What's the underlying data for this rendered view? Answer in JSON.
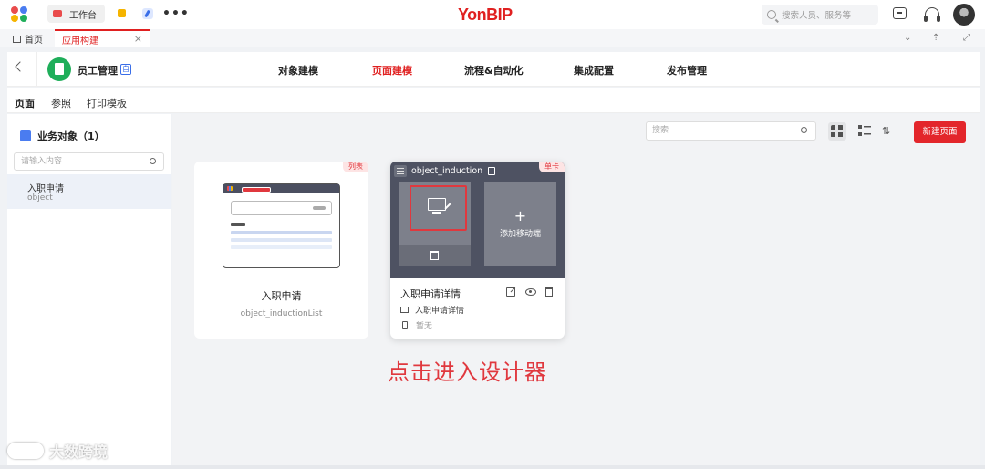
{
  "topbar": {
    "workbench_label": "工作台",
    "brand": "YonBIP",
    "search_placeholder": "搜索人员、服务等"
  },
  "tabs": {
    "home": "首页",
    "app": "应用构建",
    "close": "×"
  },
  "app_header": {
    "app_name": "员工管理",
    "badge": "自",
    "nav": [
      "对象建模",
      "页面建模",
      "流程&自动化",
      "集成配置",
      "发布管理"
    ],
    "active_nav": "页面建模"
  },
  "subtabs": [
    "页面",
    "参照",
    "打印模板"
  ],
  "sidebar": {
    "title": "业务对象（1）",
    "search_placeholder": "请输入内容",
    "items": [
      {
        "name": "入职申请",
        "code": "object"
      }
    ]
  },
  "main": {
    "search_placeholder": "搜索",
    "new_page_button": "新建页面",
    "cards": [
      {
        "tag": "列表",
        "title": "入职申请",
        "subtitle": "object_inductionList"
      },
      {
        "tag": "单卡",
        "header": "object_induction",
        "add_mobile": "添加移动端",
        "plus": "+",
        "title": "入职申请详情",
        "pc_page": "入职申请详情",
        "mobile_page": "暂无"
      }
    ]
  },
  "annotation": "点击进入设计器",
  "watermark": "大数跨境",
  "colors": {
    "accent": "#e02020",
    "primary_button": "#e3262b",
    "card_dark": "#4e5262",
    "highlight": "#e0383e"
  }
}
